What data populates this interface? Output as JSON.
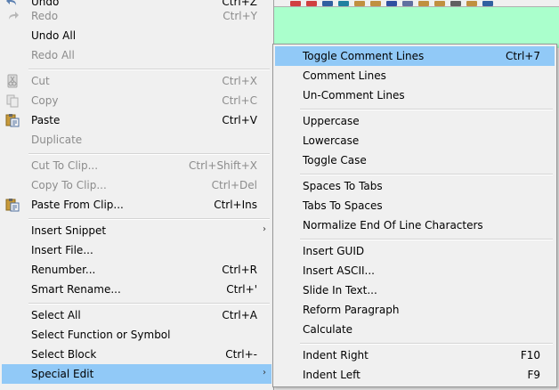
{
  "main_menu": {
    "items": [
      {
        "label": "Undo",
        "shortcut": "Ctrl+Z",
        "disabled": false
      },
      {
        "label": "Redo",
        "shortcut": "Ctrl+Y",
        "disabled": true
      },
      {
        "label": "Undo All",
        "shortcut": "",
        "disabled": false
      },
      {
        "label": "Redo All",
        "shortcut": "",
        "disabled": true
      },
      {
        "label": "Cut",
        "shortcut": "Ctrl+X",
        "disabled": true
      },
      {
        "label": "Copy",
        "shortcut": "Ctrl+C",
        "disabled": true
      },
      {
        "label": "Paste",
        "shortcut": "Ctrl+V",
        "disabled": false
      },
      {
        "label": "Duplicate",
        "shortcut": "",
        "disabled": true
      },
      {
        "label": "Cut To Clip...",
        "shortcut": "Ctrl+Shift+X",
        "disabled": true
      },
      {
        "label": "Copy To Clip...",
        "shortcut": "Ctrl+Del",
        "disabled": true
      },
      {
        "label": "Paste From Clip...",
        "shortcut": "Ctrl+Ins",
        "disabled": false
      },
      {
        "label": "Insert Snippet",
        "shortcut": "",
        "disabled": false,
        "submenu": true
      },
      {
        "label": "Insert File...",
        "shortcut": "",
        "disabled": false
      },
      {
        "label": "Renumber...",
        "shortcut": "Ctrl+R",
        "disabled": false
      },
      {
        "label": "Smart Rename...",
        "shortcut": "Ctrl+'",
        "disabled": false
      },
      {
        "label": "Select All",
        "shortcut": "Ctrl+A",
        "disabled": false
      },
      {
        "label": "Select Function or Symbol",
        "shortcut": "",
        "disabled": false
      },
      {
        "label": "Select Block",
        "shortcut": "Ctrl+-",
        "disabled": false
      },
      {
        "label": "Special Edit",
        "shortcut": "",
        "disabled": false,
        "submenu": true,
        "highlighted": true
      }
    ]
  },
  "sub_menu": {
    "items": [
      {
        "label": "Toggle Comment Lines",
        "shortcut": "Ctrl+7",
        "highlighted": true
      },
      {
        "label": "Comment Lines",
        "shortcut": ""
      },
      {
        "label": "Un-Comment Lines",
        "shortcut": ""
      },
      {
        "label": "Uppercase",
        "shortcut": ""
      },
      {
        "label": "Lowercase",
        "shortcut": ""
      },
      {
        "label": "Toggle Case",
        "shortcut": ""
      },
      {
        "label": "Spaces To Tabs",
        "shortcut": ""
      },
      {
        "label": "Tabs To Spaces",
        "shortcut": ""
      },
      {
        "label": "Normalize End Of Line Characters",
        "shortcut": ""
      },
      {
        "label": "Insert GUID",
        "shortcut": ""
      },
      {
        "label": "Insert ASCII...",
        "shortcut": ""
      },
      {
        "label": "Slide In Text...",
        "shortcut": ""
      },
      {
        "label": "Reform Paragraph",
        "shortcut": ""
      },
      {
        "label": "Calculate",
        "shortcut": ""
      },
      {
        "label": "Indent Right",
        "shortcut": "F10"
      },
      {
        "label": "Indent Left",
        "shortcut": "F9"
      }
    ]
  },
  "submenu_arrow": "›",
  "colors": {
    "highlight": "#91c9f7",
    "editor_background": "#aaffcc",
    "disabled_text": "#8c8c8c"
  }
}
